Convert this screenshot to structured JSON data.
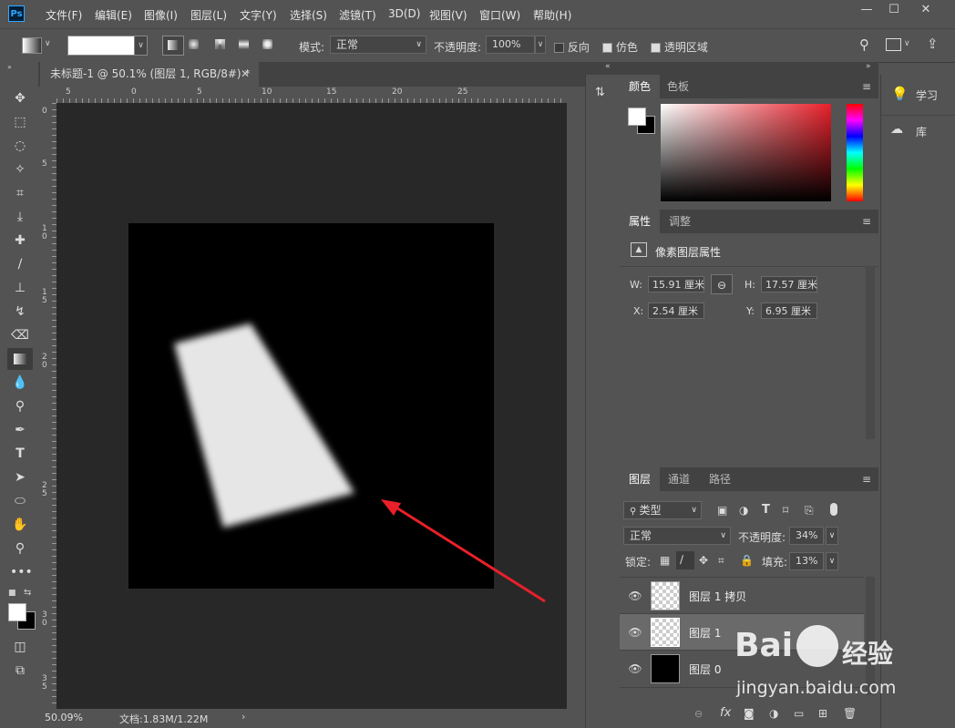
{
  "app": {
    "logo": "Ps"
  },
  "menu": [
    "文件(F)",
    "编辑(E)",
    "图像(I)",
    "图层(L)",
    "文字(Y)",
    "选择(S)",
    "滤镜(T)",
    "3D(D)",
    "视图(V)",
    "窗口(W)",
    "帮助(H)"
  ],
  "options": {
    "mode_label": "模式:",
    "mode_value": "正常",
    "opacity_label": "不透明度:",
    "opacity_value": "100%",
    "reverse_label": "反向",
    "dither_label": "仿色",
    "transparency_label": "透明区域"
  },
  "document": {
    "tab_title": "未标题-1 @ 50.1% (图层 1, RGB/8#) *",
    "zoom": "50.09%",
    "doc_info": "文档:1.83M/1.22M"
  },
  "ruler": {
    "h_ticks": [
      "5",
      "0",
      "5",
      "10",
      "15",
      "20",
      "25"
    ],
    "v_ticks": [
      "0",
      "5",
      "1 0",
      "1 5",
      "2 0",
      "2 5",
      "3 0",
      "3 5"
    ]
  },
  "color_panel": {
    "tabs": [
      "颜色",
      "色板"
    ]
  },
  "properties_panel": {
    "tabs": [
      "属性",
      "调整"
    ],
    "section_title": "像素图层属性",
    "w_label": "W:",
    "w_value": "15.91 厘米",
    "h_label": "H:",
    "h_value": "17.57 厘米",
    "x_label": "X:",
    "x_value": "2.54 厘米",
    "y_label": "Y:",
    "y_value": "6.95 厘米"
  },
  "layers_panel": {
    "tabs": [
      "图层",
      "通道",
      "路径"
    ],
    "filter_kind": "类型",
    "blend_mode": "正常",
    "opacity_label": "不透明度:",
    "opacity_value": "34%",
    "lock_label": "锁定:",
    "fill_label": "填充:",
    "fill_value": "13%",
    "layers": [
      {
        "name": "图层 1 拷贝"
      },
      {
        "name": "图层 1"
      },
      {
        "name": "图层 0"
      }
    ]
  },
  "right_panel": {
    "learn_label": "学习",
    "library_label": "库"
  },
  "watermark": {
    "text1": "Bai",
    "text2": "经验",
    "url": "jingyan.baidu.com"
  },
  "colors": {
    "annotation_arrow": "#e8202a",
    "panel_bg": "#535353",
    "canvas_bg": "#282828"
  }
}
